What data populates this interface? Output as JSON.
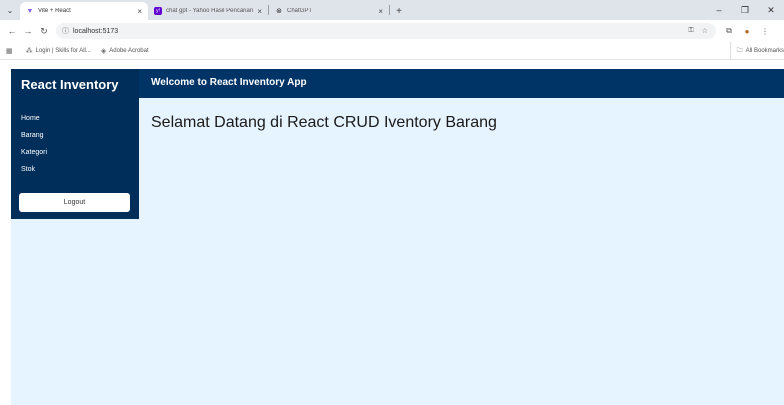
{
  "browser": {
    "tabs": [
      {
        "title": "Vite + React",
        "favicon": "vite-icon"
      },
      {
        "title": "chat gpt - Yahoo Hasil Pencarian",
        "favicon": "yahoo-icon"
      },
      {
        "title": "ChatGPT",
        "favicon": "chatgpt-icon"
      }
    ],
    "url": "localhost:5173",
    "bookmarks": [
      {
        "label": "Login | Skills for All...",
        "icon": "cisco-icon"
      },
      {
        "label": "Adobe Acrobat",
        "icon": "acrobat-icon"
      }
    ],
    "all_bookmarks": "All Bookmarks"
  },
  "app": {
    "brand": "React Inventory",
    "welcome": "Welcome to React Inventory App",
    "nav": [
      "Home",
      "Barang",
      "Kategori",
      "Stok"
    ],
    "logout": "Logout",
    "heading": "Selamat Datang di React CRUD Iventory Barang"
  },
  "colors": {
    "topbar": "#003366",
    "sidebar": "#002e5a",
    "content_bg": "#e6f4ff"
  }
}
